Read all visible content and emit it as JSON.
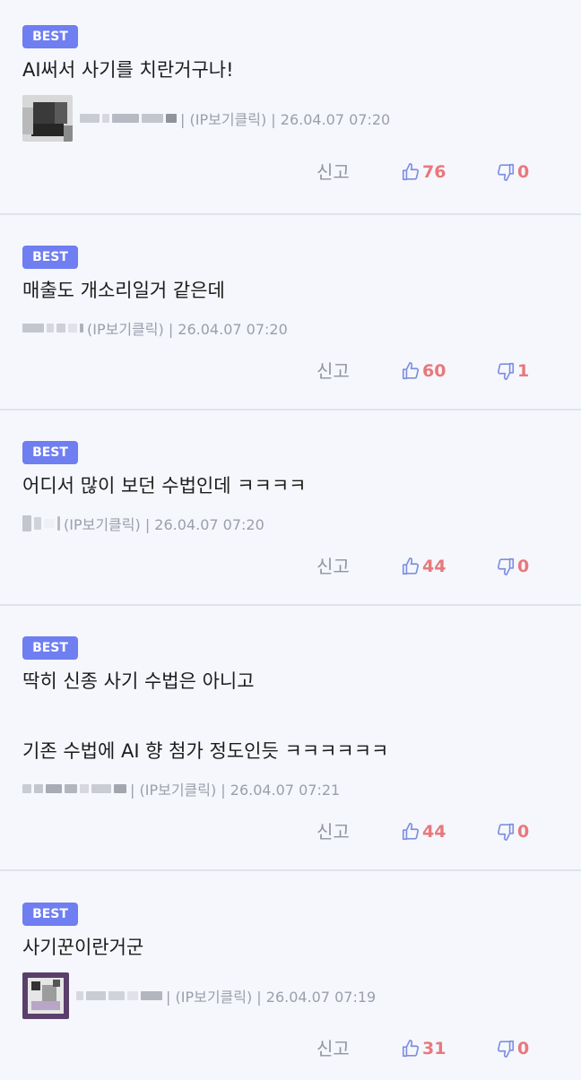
{
  "comments": [
    {
      "badge": "BEST",
      "text": "AI써서 사기를 치란거구나!",
      "ip_label": "(IP보기클릭)",
      "datetime": "26.04.07 07:20",
      "report_label": "신고",
      "likes": "76",
      "dislikes": "0"
    },
    {
      "badge": "BEST",
      "text": "매출도 개소리일거 같은데",
      "ip_label": "(IP보기클릭)",
      "datetime": "26.04.07 07:20",
      "report_label": "신고",
      "likes": "60",
      "dislikes": "1"
    },
    {
      "badge": "BEST",
      "text": "어디서 많이 보던 수법인데 ㅋㅋㅋㅋ",
      "ip_label": "(IP보기클릭)",
      "datetime": "26.04.07 07:20",
      "report_label": "신고",
      "likes": "44",
      "dislikes": "0"
    },
    {
      "badge": "BEST",
      "text_line1": "딱히 신종 사기 수법은 아니고",
      "text_line2": "기존 수법에 AI 향 첨가 정도인듯 ㅋㅋㅋㅋㅋㅋ",
      "ip_label": "(IP보기클릭)",
      "datetime": "26.04.07 07:21",
      "report_label": "신고",
      "likes": "44",
      "dislikes": "0"
    },
    {
      "badge": "BEST",
      "text": "사기꾼이란거군",
      "ip_label": "(IP보기클릭)",
      "datetime": "26.04.07 07:19",
      "report_label": "신고",
      "likes": "31",
      "dislikes": "0"
    }
  ],
  "icons": {
    "like": "thumbs-up-icon",
    "dislike": "thumbs-down-icon"
  },
  "colors": {
    "badge": "#6f7ef0",
    "count": "#e8787c",
    "icon": "#7d8fe0",
    "meta": "#9a9fab",
    "divider": "#dfe3ec",
    "background": "#f5f7fc"
  }
}
